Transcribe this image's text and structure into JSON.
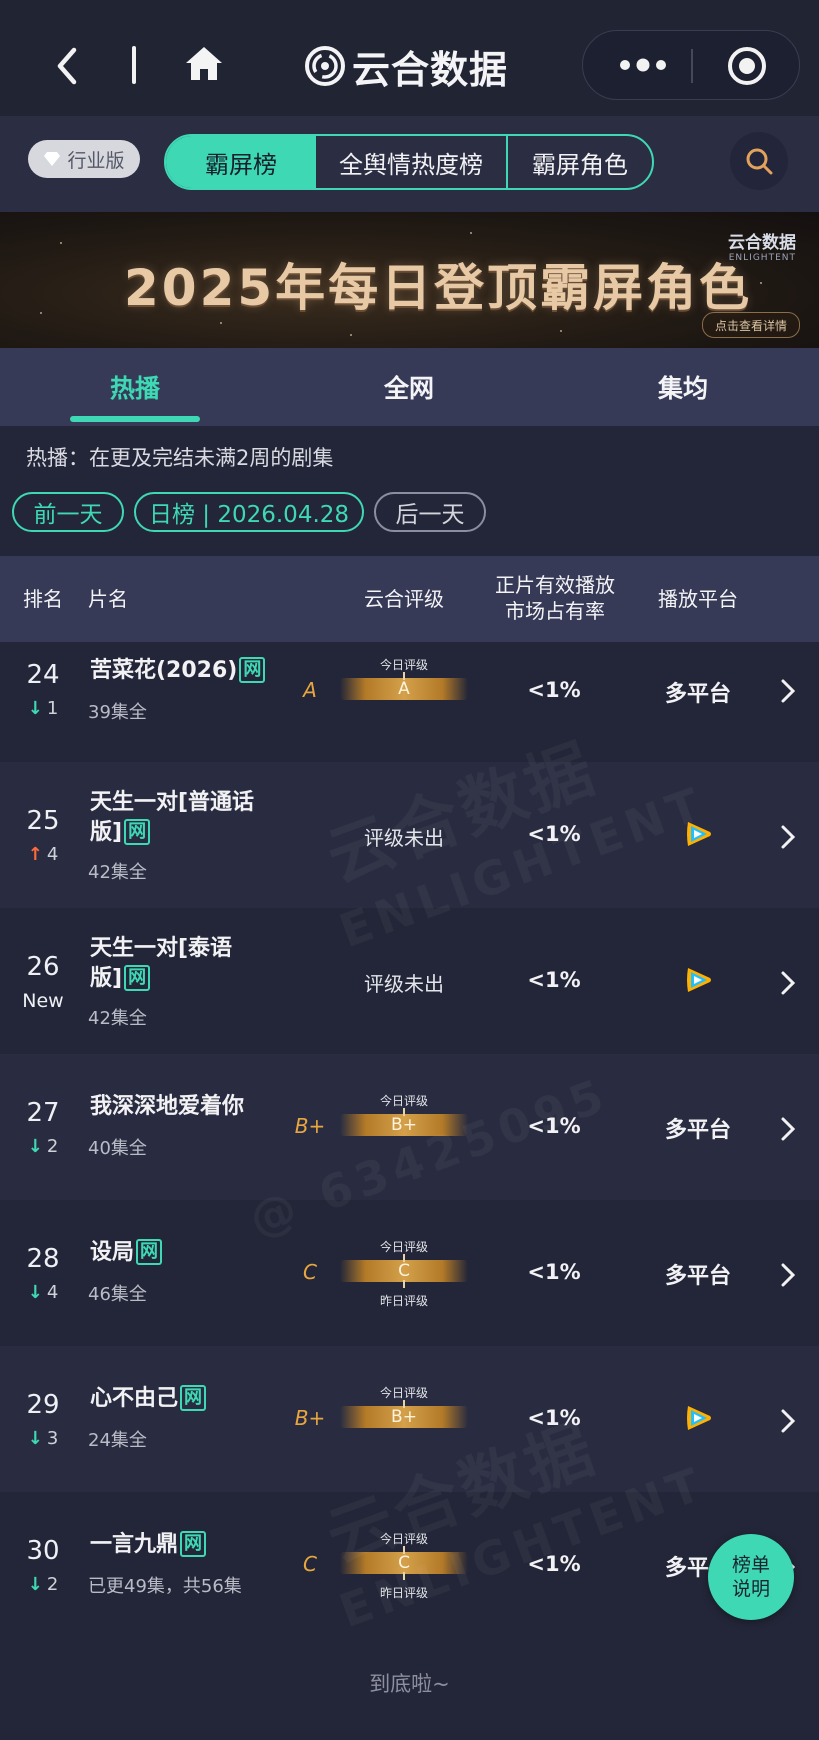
{
  "topbar": {
    "title": "云合数据"
  },
  "filters": {
    "edition_badge": "行业版",
    "segments": [
      "霸屏榜",
      "全舆情热度榜",
      "霸屏角色"
    ]
  },
  "banner": {
    "headline": "2025年每日登顶霸屏角色",
    "brand": "云合数据",
    "brand_en": "ENLIGHTENT",
    "detail_button": "点击查看详情"
  },
  "tabs": [
    "热播",
    "全网",
    "集均"
  ],
  "description": "热播：在更及完结未满2周的剧集",
  "date_nav": {
    "prev": "前一天",
    "current": "日榜 | 2026.04.28",
    "next": "后一天"
  },
  "table": {
    "headers": {
      "rank": "排名",
      "title": "片名",
      "rating": "云合评级",
      "share_line1": "正片有效播放",
      "share_line2": "市场占有率",
      "platform": "播放平台"
    },
    "grade_label_today": "今日评级",
    "grade_label_yesterday": "昨日评级",
    "rows": [
      {
        "rank": "24",
        "change": "1",
        "title": "苦菜花(2026)",
        "tag": "网",
        "eps": "39集全",
        "grade": "A",
        "share": "<1%",
        "platform": "多平台"
      },
      {
        "rank": "25",
        "change": "4",
        "title_line1": "天生一对[普通话",
        "title_line2": "版]",
        "tag": "网",
        "eps": "42集全",
        "rating_text": "评级未出",
        "share": "<1%",
        "platform_icon": "tencent-video-icon"
      },
      {
        "rank": "26",
        "change": "New",
        "title_line1": "天生一对[泰语",
        "title_line2": "版]",
        "tag": "网",
        "eps": "42集全",
        "rating_text": "评级未出",
        "share": "<1%",
        "platform_icon": "tencent-video-icon"
      },
      {
        "rank": "27",
        "change": "2",
        "title": "我深深地爱着你",
        "eps": "40集全",
        "grade": "B+",
        "share": "<1%",
        "platform": "多平台"
      },
      {
        "rank": "28",
        "change": "4",
        "title": "设局",
        "tag": "网",
        "eps": "46集全",
        "grade": "C",
        "share": "<1%",
        "platform": "多平台"
      },
      {
        "rank": "29",
        "change": "3",
        "title": "心不由己",
        "tag": "网",
        "eps": "24集全",
        "grade": "B+",
        "share": "<1%",
        "platform_icon": "tencent-video-icon"
      },
      {
        "rank": "30",
        "change": "2",
        "title": "一言九鼎",
        "tag": "网",
        "eps": "已更49集，共56集",
        "grade": "C",
        "share": "<1%",
        "platform": "多平台"
      }
    ]
  },
  "watermark": {
    "brand": "云合数据",
    "brand_en": "ENLIGHTENT",
    "handle": "@ 63425095"
  },
  "fab": {
    "line1": "榜单",
    "line2": "说明"
  },
  "footer": "到底啦~",
  "colors": {
    "accent": "#3ed9b4",
    "down": "#3ed9b4",
    "up": "#ff6a3d",
    "grade": "#e7a640"
  }
}
